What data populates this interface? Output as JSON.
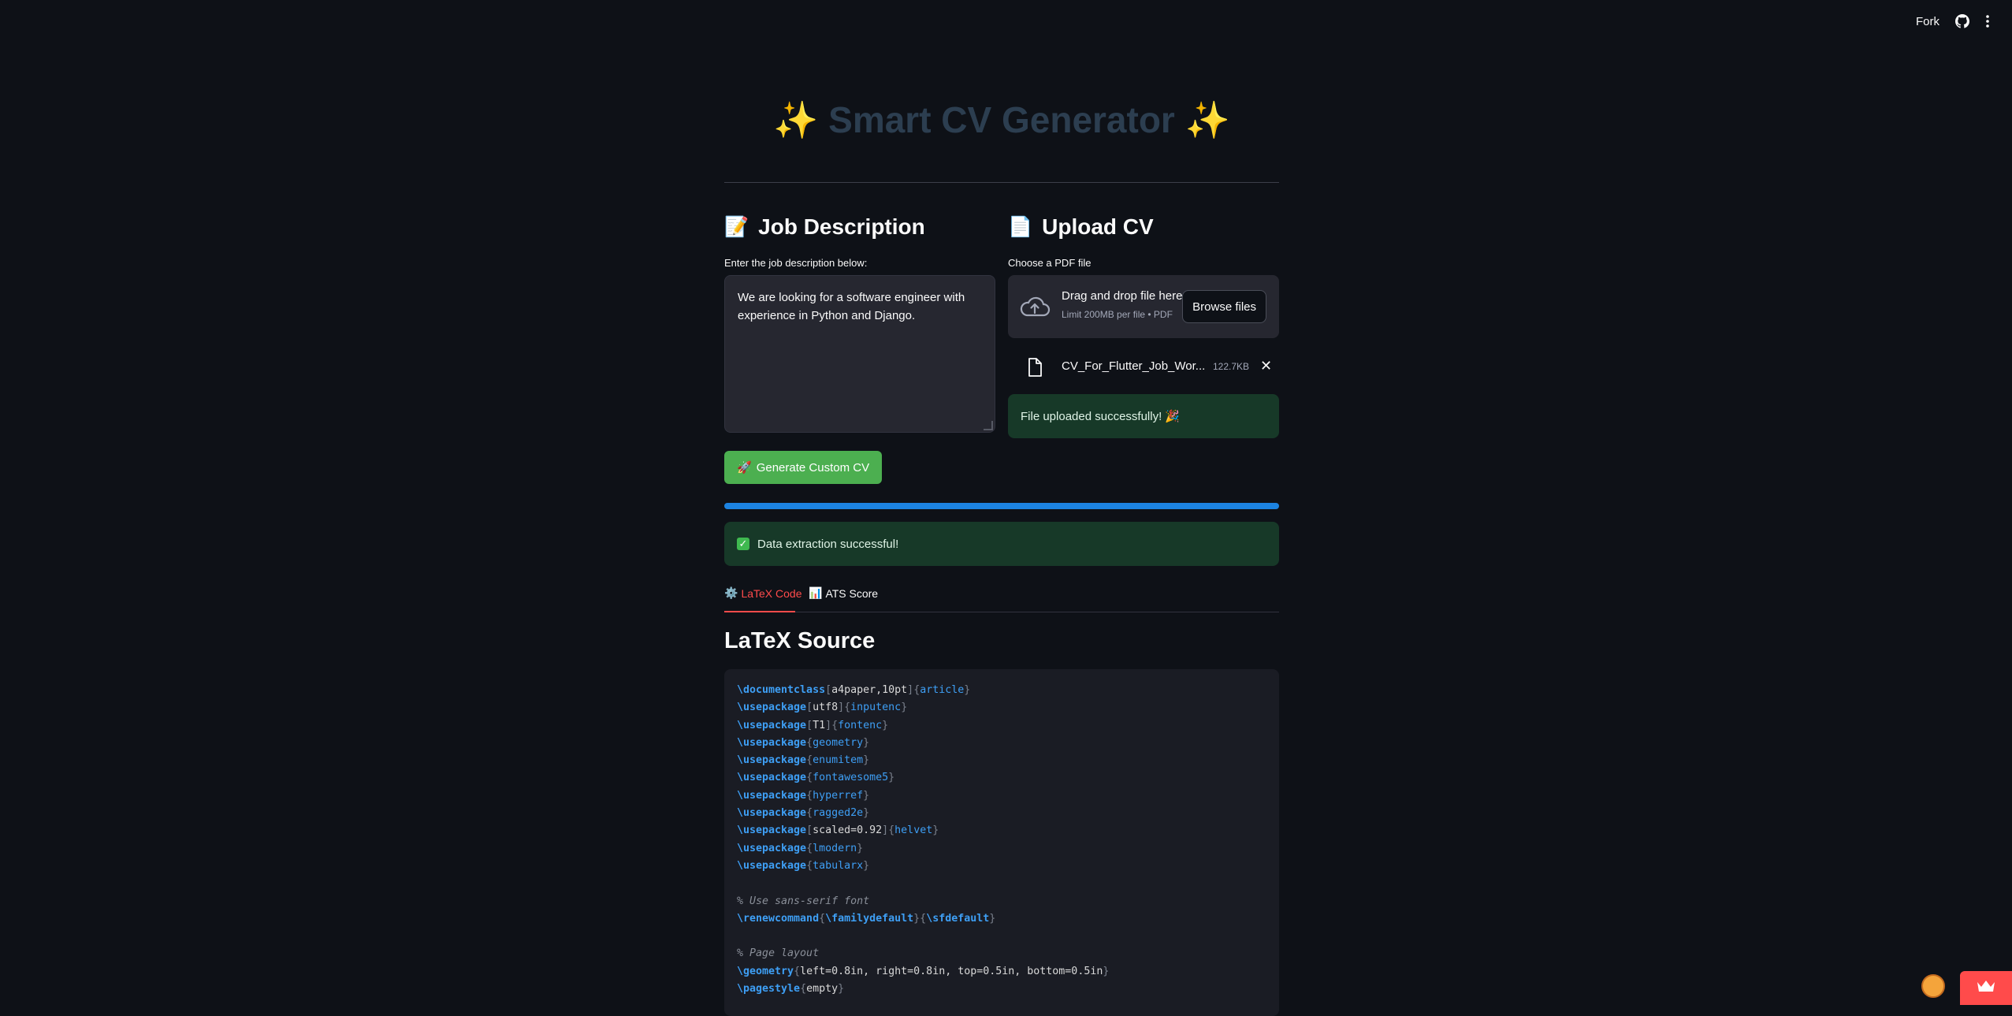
{
  "toolbar": {
    "fork_label": "Fork",
    "github_icon": "github-icon",
    "menu_icon": "kebab-menu-icon"
  },
  "title": {
    "spark_left": "✨",
    "text": "Smart CV Generator",
    "spark_right": "✨",
    "color": "#2c3e50"
  },
  "job": {
    "heading_emoji": "📝",
    "heading": "Job Description",
    "label": "Enter the job description below:",
    "value": "We are looking for a software engineer with experience in Python and Django."
  },
  "upload": {
    "heading_emoji": "📄",
    "heading": "Upload CV",
    "label": "Choose a PDF file",
    "drop_title": "Drag and drop file here",
    "drop_sub": "Limit 200MB per file • PDF",
    "browse_label": "Browse files",
    "file_name": "CV_For_Flutter_Job_Wor...",
    "file_size": "122.7KB",
    "remove_glyph": "✕",
    "success": "File uploaded successfully! 🎉"
  },
  "generate": {
    "emoji": "🚀",
    "label": "Generate Custom CV",
    "color": "#4caf50"
  },
  "progress": {
    "value": 1.0,
    "color": "#1c83e1"
  },
  "extract": {
    "check": "✓",
    "message": "Data extraction successful!"
  },
  "tabs": [
    {
      "emoji": "⚙️",
      "label": "LaTeX Code",
      "active": true
    },
    {
      "emoji": "📊",
      "label": "ATS Score",
      "active": false
    }
  ],
  "latex": {
    "heading": "LaTeX Source",
    "lines": [
      [
        [
          "kw",
          "\\documentclass"
        ],
        [
          "br",
          "["
        ],
        [
          "opt",
          "a4paper,10pt"
        ],
        [
          "br",
          "]"
        ],
        [
          "br",
          "{"
        ],
        [
          "arg",
          "article"
        ],
        [
          "br",
          "}"
        ]
      ],
      [
        [
          "kw",
          "\\usepackage"
        ],
        [
          "br",
          "["
        ],
        [
          "opt",
          "utf8"
        ],
        [
          "br",
          "]"
        ],
        [
          "br",
          "{"
        ],
        [
          "arg",
          "inputenc"
        ],
        [
          "br",
          "}"
        ]
      ],
      [
        [
          "kw",
          "\\usepackage"
        ],
        [
          "br",
          "["
        ],
        [
          "opt",
          "T1"
        ],
        [
          "br",
          "]"
        ],
        [
          "br",
          "{"
        ],
        [
          "arg",
          "fontenc"
        ],
        [
          "br",
          "}"
        ]
      ],
      [
        [
          "kw",
          "\\usepackage"
        ],
        [
          "br",
          "{"
        ],
        [
          "arg",
          "geometry"
        ],
        [
          "br",
          "}"
        ]
      ],
      [
        [
          "kw",
          "\\usepackage"
        ],
        [
          "br",
          "{"
        ],
        [
          "arg",
          "enumitem"
        ],
        [
          "br",
          "}"
        ]
      ],
      [
        [
          "kw",
          "\\usepackage"
        ],
        [
          "br",
          "{"
        ],
        [
          "arg",
          "fontawesome5"
        ],
        [
          "br",
          "}"
        ]
      ],
      [
        [
          "kw",
          "\\usepackage"
        ],
        [
          "br",
          "{"
        ],
        [
          "arg",
          "hyperref"
        ],
        [
          "br",
          "}"
        ]
      ],
      [
        [
          "kw",
          "\\usepackage"
        ],
        [
          "br",
          "{"
        ],
        [
          "arg",
          "ragged2e"
        ],
        [
          "br",
          "}"
        ]
      ],
      [
        [
          "kw",
          "\\usepackage"
        ],
        [
          "br",
          "["
        ],
        [
          "opt",
          "scaled=0.92"
        ],
        [
          "br",
          "]"
        ],
        [
          "br",
          "{"
        ],
        [
          "arg",
          "helvet"
        ],
        [
          "br",
          "}"
        ]
      ],
      [
        [
          "kw",
          "\\usepackage"
        ],
        [
          "br",
          "{"
        ],
        [
          "arg",
          "lmodern"
        ],
        [
          "br",
          "}"
        ]
      ],
      [
        [
          "kw",
          "\\usepackage"
        ],
        [
          "br",
          "{"
        ],
        [
          "arg",
          "tabularx"
        ],
        [
          "br",
          "}"
        ]
      ],
      [],
      [
        [
          "cm",
          "% Use sans-serif font"
        ]
      ],
      [
        [
          "kw",
          "\\renewcommand"
        ],
        [
          "br",
          "{"
        ],
        [
          "kw",
          "\\familydefault"
        ],
        [
          "br",
          "}{"
        ],
        [
          "kw",
          "\\sfdefault"
        ],
        [
          "br",
          "}"
        ]
      ],
      [],
      [
        [
          "cm",
          "% Page layout"
        ]
      ],
      [
        [
          "kw",
          "\\geometry"
        ],
        [
          "br",
          "{"
        ],
        [
          "opt",
          "left=0.8in, right=0.8in, top=0.5in, bottom=0.5in"
        ],
        [
          "br",
          "}"
        ]
      ],
      [
        [
          "kw",
          "\\pagestyle"
        ],
        [
          "br",
          "{"
        ],
        [
          "opt",
          "empty"
        ],
        [
          "br",
          "}"
        ]
      ]
    ]
  }
}
